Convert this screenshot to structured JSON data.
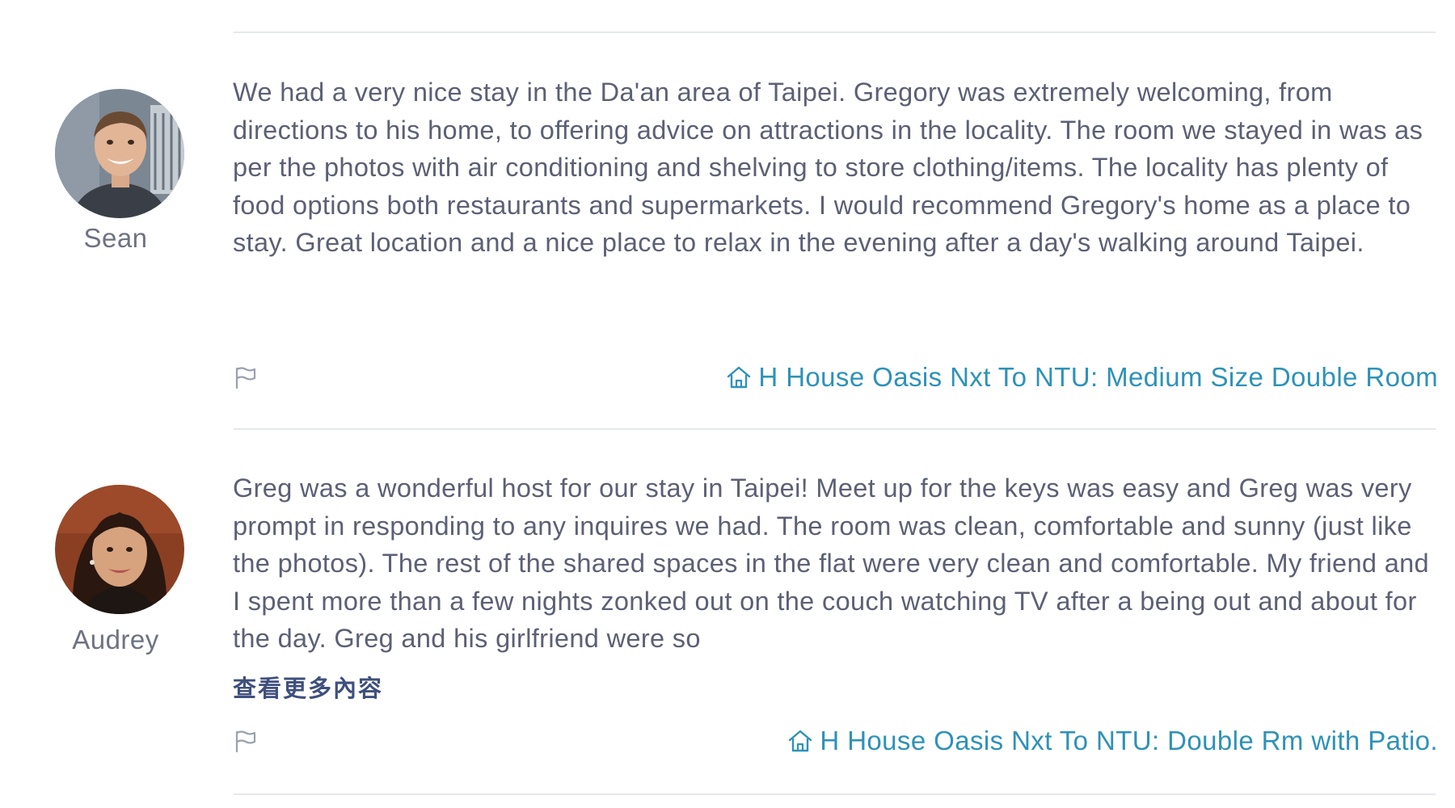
{
  "reviews": [
    {
      "reviewer": "Sean",
      "text": "We had a very nice stay in the Da'an area of Taipei. Gregory was extremely welcoming, from directions to his home, to offering advice on attractions in the locality. The room we stayed in was as per the photos with air conditioning and shelving to store clothing/items. The locality has plenty of food options both restaurants and supermarkets. I would recommend Gregory's home as a place to stay. Great location and a nice place to relax in the evening after a day's walking around Taipei.",
      "listing": "H House Oasis Nxt To NTU: Medium Size Double Room",
      "icons": {
        "report": "flag-icon",
        "listing": "home-icon"
      }
    },
    {
      "reviewer": "Audrey",
      "text": "Greg was a wonderful host for our stay in Taipei! Meet up for the keys was easy and Greg was very prompt in responding to any inquires we had. The room was clean, comfortable and sunny (just like the photos). The rest of the shared spaces in the flat were very clean and comfortable. My friend and I spent more than a few nights zonked out on the couch watching TV after a being out and about for the day. Greg and his girlfriend were so",
      "read_more": "查看更多內容",
      "listing": "H House Oasis Nxt To NTU: Double Rm with Patio.",
      "icons": {
        "report": "flag-icon",
        "listing": "home-icon"
      }
    }
  ],
  "colors": {
    "text": "#5c6075",
    "name": "#6e7283",
    "link": "#2e92b7",
    "divider": "#e6e8ee",
    "read_more": "#3f4f7e"
  }
}
